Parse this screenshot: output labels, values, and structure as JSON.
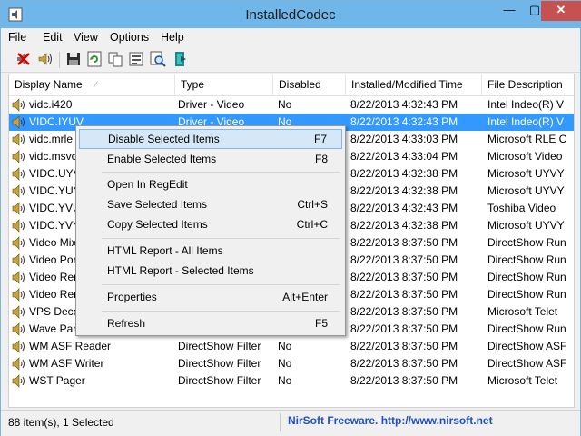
{
  "window": {
    "title": "InstalledCodec",
    "close_glyph": "✕",
    "min_glyph": "—",
    "max_glyph": "▢"
  },
  "menu": [
    "File",
    "Edit",
    "View",
    "Options",
    "Help"
  ],
  "toolbar": [
    {
      "icon": "disable-items-icon"
    },
    {
      "icon": "enable-items-icon"
    },
    {
      "icon": "save-icon"
    },
    {
      "icon": "refresh-icon"
    },
    {
      "icon": "copy-icon"
    },
    {
      "icon": "properties-icon"
    },
    {
      "icon": "find-icon"
    },
    {
      "icon": "exit-icon"
    }
  ],
  "columns": [
    "Display Name",
    "Type",
    "Disabled",
    "Installed/Modified Time",
    "File Description"
  ],
  "rows": [
    {
      "name": "vidc.i420",
      "type": "Driver - Video",
      "disabled": "No",
      "time": "8/22/2013 4:32:43 PM",
      "desc": "Intel Indeo(R) V"
    },
    {
      "name": "VIDC.IYUV",
      "type": "Driver - Video",
      "disabled": "No",
      "time": "8/22/2013 4:32:43 PM",
      "desc": "Intel Indeo(R) V"
    },
    {
      "name": "vidc.mrle",
      "type": "",
      "disabled": "",
      "time": "8/22/2013 4:33:03 PM",
      "desc": "Microsoft RLE C"
    },
    {
      "name": "vidc.msvc",
      "type": "",
      "disabled": "",
      "time": "8/22/2013 4:33:04 PM",
      "desc": "Microsoft Video"
    },
    {
      "name": "VIDC.UYVY",
      "type": "",
      "disabled": "",
      "time": "8/22/2013 4:32:38 PM",
      "desc": "Microsoft UYVY"
    },
    {
      "name": "VIDC.YUY2",
      "type": "",
      "disabled": "",
      "time": "8/22/2013 4:32:38 PM",
      "desc": "Microsoft UYVY"
    },
    {
      "name": "VIDC.YVU9",
      "type": "",
      "disabled": "",
      "time": "8/22/2013 4:32:43 PM",
      "desc": "Toshiba Video"
    },
    {
      "name": "VIDC.YVYU",
      "type": "",
      "disabled": "",
      "time": "8/22/2013 4:32:38 PM",
      "desc": "Microsoft UYVY"
    },
    {
      "name": "Video Mix",
      "type": "",
      "disabled": "",
      "time": "8/22/2013 8:37:50 PM",
      "desc": "DirectShow Run"
    },
    {
      "name": "Video Por",
      "type": "",
      "disabled": "",
      "time": "8/22/2013 8:37:50 PM",
      "desc": "DirectShow Run"
    },
    {
      "name": "Video Ren",
      "type": "",
      "disabled": "",
      "time": "8/22/2013 8:37:50 PM",
      "desc": "DirectShow Run"
    },
    {
      "name": "Video Ren",
      "type": "",
      "disabled": "",
      "time": "8/22/2013 8:37:50 PM",
      "desc": "DirectShow Run"
    },
    {
      "name": "VPS Deco",
      "type": "",
      "disabled": "",
      "time": "8/22/2013 8:37:50 PM",
      "desc": "Microsoft Telet"
    },
    {
      "name": "Wave Pars",
      "type": "",
      "disabled": "",
      "time": "8/22/2013 8:37:50 PM",
      "desc": "DirectShow Run"
    },
    {
      "name": "WM ASF Reader",
      "type": "DirectShow Filter",
      "disabled": "No",
      "time": "8/22/2013 8:37:50 PM",
      "desc": "DirectShow ASF"
    },
    {
      "name": "WM ASF Writer",
      "type": "DirectShow Filter",
      "disabled": "No",
      "time": "8/22/2013 8:37:50 PM",
      "desc": "DirectShow ASF"
    },
    {
      "name": "WST Pager",
      "type": "DirectShow Filter",
      "disabled": "No",
      "time": "8/22/2013 8:37:50 PM",
      "desc": "Microsoft Telet"
    }
  ],
  "context_menu": [
    {
      "label": "Disable Selected Items",
      "shortcut": "F7"
    },
    {
      "label": "Enable Selected Items",
      "shortcut": "F8"
    },
    {
      "label": "Open In RegEdit",
      "shortcut": ""
    },
    {
      "label": "Save Selected Items",
      "shortcut": "Ctrl+S"
    },
    {
      "label": "Copy Selected Items",
      "shortcut": "Ctrl+C"
    },
    {
      "label": "HTML Report - All Items",
      "shortcut": ""
    },
    {
      "label": "HTML Report - Selected Items",
      "shortcut": ""
    },
    {
      "label": "Properties",
      "shortcut": "Alt+Enter"
    },
    {
      "label": "Refresh",
      "shortcut": "F5"
    }
  ],
  "status": {
    "count": "88 item(s), 1 Selected",
    "credit": "NirSoft Freeware.  http://www.nirsoft.net"
  }
}
